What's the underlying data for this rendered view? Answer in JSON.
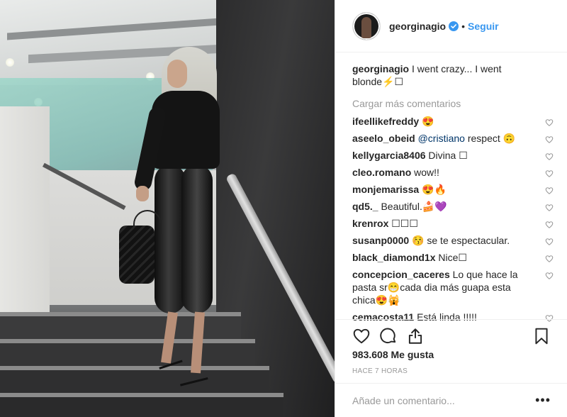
{
  "header": {
    "username": "georginagio",
    "verified_icon": "verified-badge-icon",
    "separator": "•",
    "follow_label": "Seguir"
  },
  "caption": {
    "username": "georginagio",
    "text": "I went crazy... I went blonde⚡☐"
  },
  "load_more_label": "Cargar más comentarios",
  "comments": [
    {
      "user": "ifeellikefreddy",
      "text": "😍",
      "mention": ""
    },
    {
      "user": "aseelo_obeid",
      "mention": "@cristiano",
      "text": "respect 🙃"
    },
    {
      "user": "kellygarcia8406",
      "text": "Divina ☐",
      "mention": ""
    },
    {
      "user": "cleo.romano",
      "text": "wow!!",
      "mention": ""
    },
    {
      "user": "monjemarissa",
      "text": "😍🔥",
      "mention": ""
    },
    {
      "user": "qd5._",
      "text": "Beautiful.🍰💜",
      "mention": ""
    },
    {
      "user": "krenrox",
      "text": "☐☐☐",
      "mention": ""
    },
    {
      "user": "susanp0000",
      "text": "😚 se te espectacular.",
      "mention": ""
    },
    {
      "user": "black_diamond1x",
      "text": "Nice☐",
      "mention": ""
    },
    {
      "user": "concepcion_caceres",
      "text": "Lo que hace la pasta sr😁cada dia más guapa esta chica😍🙀",
      "mention": ""
    },
    {
      "user": "cemacosta11",
      "text": "Está linda !!!!!",
      "mention": ""
    }
  ],
  "icons": {
    "like": "heart-icon",
    "comment": "comment-icon",
    "share": "share-icon",
    "save": "bookmark-icon",
    "more": "more-options-icon"
  },
  "likes_label": "983.608 Me gusta",
  "time_label": "HACE 7 HORAS",
  "add_comment": {
    "placeholder": "Añade un comentario...",
    "more_label": "•••"
  }
}
